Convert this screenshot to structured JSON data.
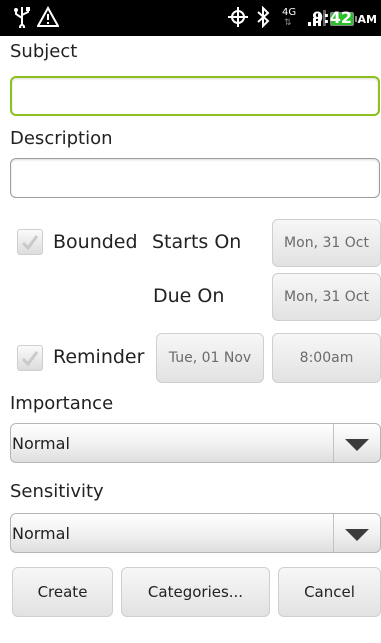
{
  "status_bar": {
    "time": "9:42",
    "ampm": "AM",
    "network": "4G",
    "icons": [
      "usb-icon",
      "warning-icon",
      "gps-icon",
      "bluetooth-icon",
      "network-4g-icon",
      "signal-icon",
      "battery-icon"
    ]
  },
  "form": {
    "subject_label": "Subject",
    "subject_value": "",
    "description_label": "Description",
    "description_value": "",
    "bounded_label": "Bounded",
    "bounded_checked": true,
    "starts_on_label": "Starts On",
    "starts_on_date": "Mon, 31 Oct",
    "due_on_label": "Due On",
    "due_on_date": "Mon, 31 Oct",
    "reminder_label": "Reminder",
    "reminder_checked": true,
    "reminder_date": "Tue, 01 Nov",
    "reminder_time": "8:00am",
    "importance_label": "Importance",
    "importance_value": "Normal",
    "sensitivity_label": "Sensitivity",
    "sensitivity_value": "Normal"
  },
  "buttons": {
    "create": "Create",
    "categories": "Categories...",
    "cancel": "Cancel"
  },
  "colors": {
    "focus_border": "#8cc21f",
    "battery": "#2bbf2b"
  }
}
